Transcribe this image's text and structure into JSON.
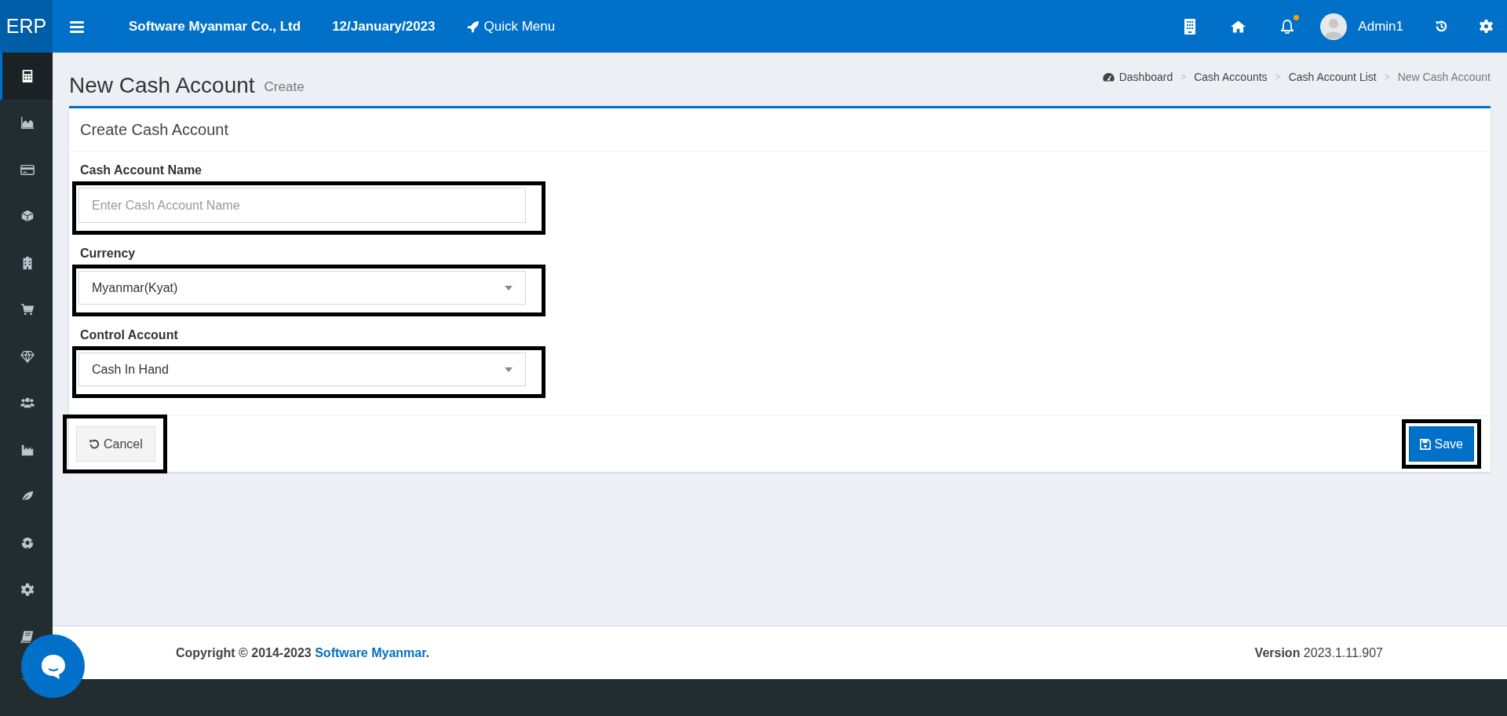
{
  "topbar": {
    "logo": "ERP",
    "company": "Software Myanmar Co., Ltd",
    "date": "12/January/2023",
    "quick_menu": "Quick Menu",
    "notification_dot": true,
    "user": "Admin1"
  },
  "sidebar": {
    "items": [
      {
        "selected": true
      },
      {
        "selected": false
      },
      {
        "selected": false
      },
      {
        "selected": false
      },
      {
        "selected": false
      },
      {
        "selected": false
      },
      {
        "selected": false
      },
      {
        "selected": false
      },
      {
        "selected": false
      },
      {
        "selected": false
      },
      {
        "selected": false
      },
      {
        "selected": false
      },
      {
        "selected": false
      },
      {
        "selected": false
      }
    ]
  },
  "page": {
    "title": "New Cash Account",
    "subtitle": "Create"
  },
  "breadcrumb": [
    {
      "label": "Dashboard",
      "current": false
    },
    {
      "label": "Cash Accounts",
      "current": false
    },
    {
      "label": "Cash Account List",
      "current": false
    },
    {
      "label": "New Cash Account",
      "current": true
    }
  ],
  "breadcrumb_separator": ">",
  "card": {
    "title": "Create Cash Account",
    "fields": [
      {
        "kind": "text",
        "label": "Cash Account Name",
        "placeholder": "Enter Cash Account Name",
        "highlighted": true
      },
      {
        "kind": "select",
        "label": "Currency",
        "value": "Myanmar(Kyat)",
        "highlighted": true
      },
      {
        "kind": "select",
        "label": "Control Account",
        "value": "Cash In Hand",
        "highlighted": true
      }
    ],
    "buttons": [
      {
        "kind": "cancel",
        "label": "Cancel",
        "highlighted": true
      },
      {
        "kind": "save",
        "label": "Save",
        "highlighted": true
      }
    ]
  },
  "footer": {
    "copyright": "Copyright © 2014-2023",
    "company_link": "Software Myanmar",
    "period": ".",
    "version_label": "Version",
    "version": "2023.1.11.907"
  }
}
